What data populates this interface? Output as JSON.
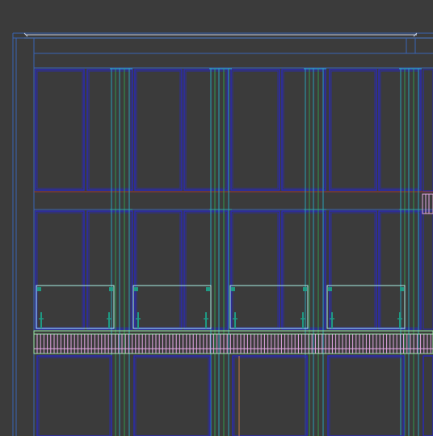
{
  "drawing": {
    "type": "cad-elevation",
    "background": "#3b3b3b",
    "colors": {
      "outline": "#3a64b4",
      "frame_blue": "#2a2ab4",
      "mullion_green": "#2f9a4c",
      "mullion_cyan": "#2aa0b4",
      "sill_red": "#9a3a3a",
      "railing_cyan": "#a8f0e6",
      "post_teal": "#1f9a84",
      "balustrade_pink": "#e6a8e6",
      "balustrade_green": "#9aeaa8",
      "door_orange": "#c8784a"
    },
    "window_columns": 8,
    "upper_window_row": true,
    "lower_window_row": true,
    "balcony_railings": 4,
    "ground_openings": 4
  }
}
